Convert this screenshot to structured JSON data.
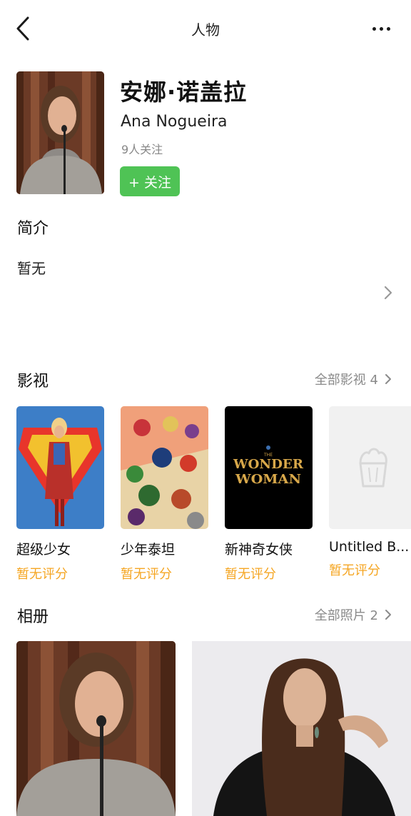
{
  "nav": {
    "title": "人物"
  },
  "person": {
    "name_cn": "安娜·诺盖拉",
    "name_en": "Ana Nogueira",
    "followers": "9人关注",
    "follow_label": "+ 关注"
  },
  "intro": {
    "title": "简介",
    "text": "暂无"
  },
  "films": {
    "title": "影视",
    "see_all": "全部影视 4",
    "items": [
      {
        "title": "超级少女",
        "rating": "暂无评分"
      },
      {
        "title": "少年泰坦",
        "rating": "暂无评分"
      },
      {
        "title": "新神奇女侠",
        "rating": "暂无评分",
        "poster_text": [
          "THE",
          "WONDER",
          "WOMAN"
        ]
      },
      {
        "title": "Untitled B...",
        "rating": "暂无评分"
      }
    ]
  },
  "album": {
    "title": "相册",
    "see_all": "全部照片 2"
  },
  "colors": {
    "accent_green": "#4fc355",
    "rating_orange": "#f5a623",
    "muted": "#8a8a8a"
  }
}
